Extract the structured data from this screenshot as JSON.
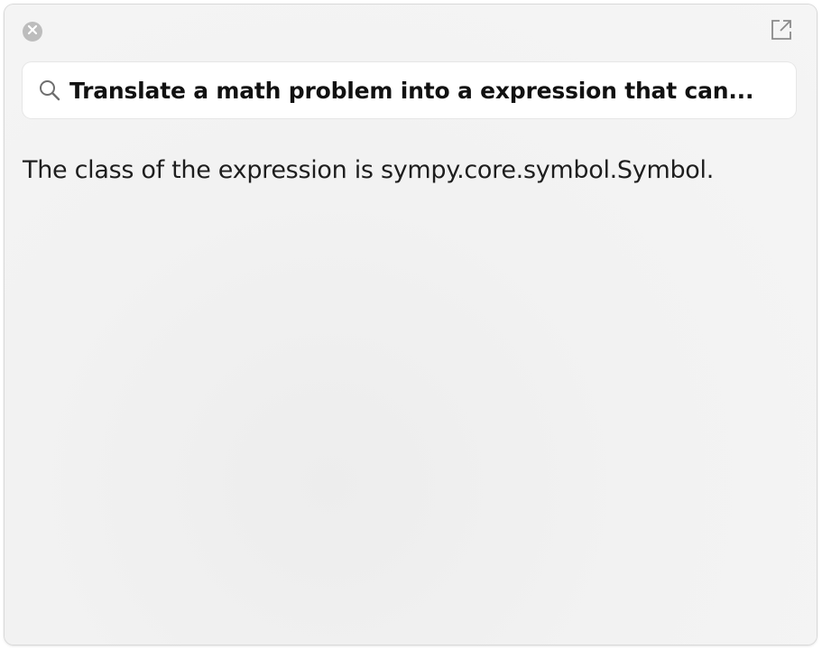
{
  "toolbar": {
    "close_icon": "close-circle-icon",
    "open_external_icon": "open-external-icon"
  },
  "search": {
    "icon": "search-icon",
    "query": "Translate a math problem into a expression that can..."
  },
  "result": {
    "text": "The class of the expression is sympy.core.symbol.Symbol."
  }
}
